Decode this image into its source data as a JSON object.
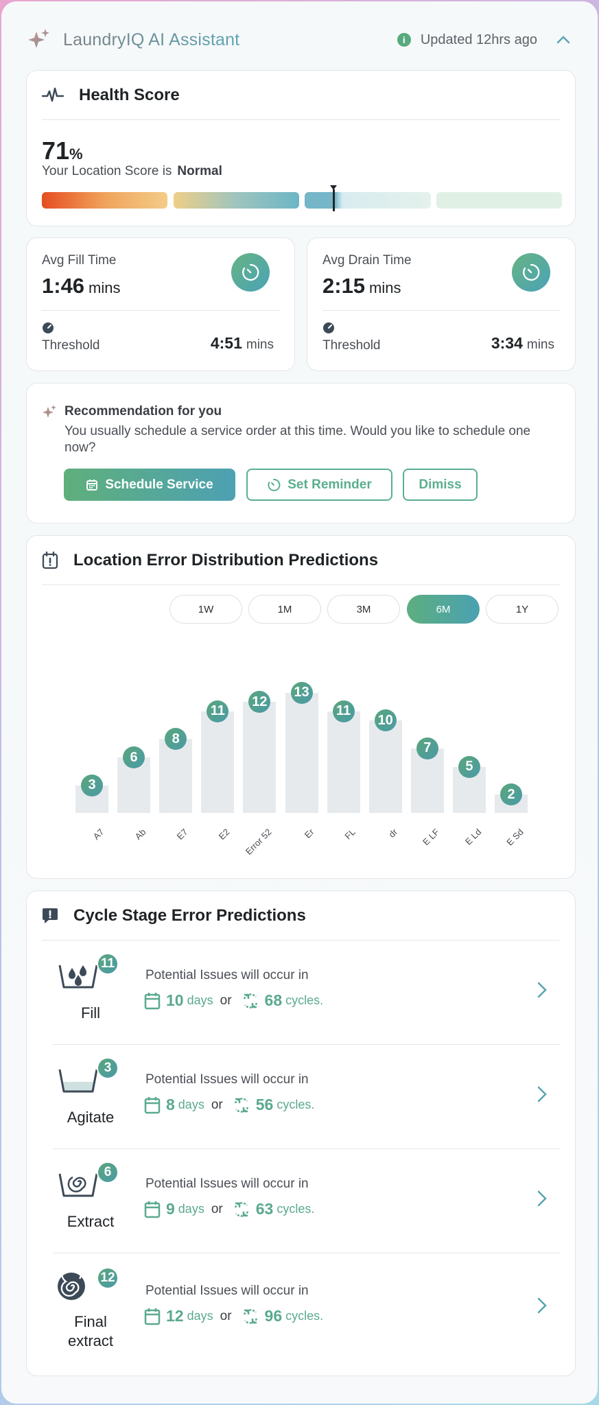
{
  "header": {
    "title": "LaundryIQ AI Assistant",
    "updated": "Updated 12hrs ago",
    "info": "i"
  },
  "health": {
    "title": "Health Score",
    "value": "71",
    "unit": "%",
    "sub_prefix": "Your Location Score is",
    "status": "Normal",
    "score_fraction": 0.71
  },
  "fill": {
    "label": "Avg Fill Time",
    "value": "1:46",
    "unit": "mins",
    "threshold_label": "Threshold",
    "threshold_value": "4:51",
    "threshold_unit": "mins"
  },
  "drain": {
    "label": "Avg Drain Time",
    "value": "2:15",
    "unit": "mins",
    "threshold_label": "Threshold",
    "threshold_value": "3:34",
    "threshold_unit": "mins"
  },
  "recommendation": {
    "title": "Recommendation for you",
    "body": "You usually schedule a service order at this time. Would you like to schedule one now?",
    "primary": "Schedule Service",
    "reminder": "Set Reminder",
    "dismiss": "Dimiss"
  },
  "chart_card": {
    "title": "Location Error Distribution Predictions",
    "ranges": [
      "1W",
      "1M",
      "3M",
      "6M",
      "1Y"
    ],
    "active_range": "6M"
  },
  "chart_data": {
    "type": "bar",
    "categories": [
      "A7",
      "Ab",
      "E7",
      "E2",
      "Error 52",
      "Er",
      "FL",
      "dr",
      "E LF",
      "E Ld",
      "E Sd"
    ],
    "values": [
      3,
      6,
      8,
      11,
      12,
      13,
      11,
      10,
      7,
      5,
      2
    ],
    "title": "",
    "xlabel": "",
    "ylabel": ""
  },
  "stages": {
    "title": "Cycle Stage Error Predictions",
    "items": [
      {
        "name": "Fill",
        "count": "11",
        "prompt": "Potential Issues will occur in",
        "days": "10",
        "days_unit": "days",
        "or": "or",
        "cycles": "68",
        "cycles_unit": "cycles."
      },
      {
        "name": "Agitate",
        "count": "3",
        "prompt": "Potential Issues will occur in",
        "days": "8",
        "days_unit": "days",
        "or": "or",
        "cycles": "56",
        "cycles_unit": "cycles."
      },
      {
        "name": "Extract",
        "count": "6",
        "prompt": "Potential Issues will occur in",
        "days": "9",
        "days_unit": "days",
        "or": "or",
        "cycles": "63",
        "cycles_unit": "cycles."
      },
      {
        "name": "Final extract",
        "count": "12",
        "prompt": "Potential Issues will occur in",
        "days": "12",
        "days_unit": "days",
        "or": "or",
        "cycles": "96",
        "cycles_unit": "cycles."
      }
    ]
  }
}
